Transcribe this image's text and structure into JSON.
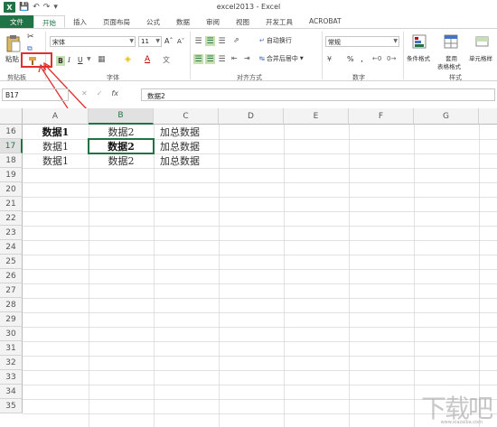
{
  "app": {
    "window_title": "excel2013 - Excel",
    "logo": "X"
  },
  "tabs": [
    "文件",
    "开始",
    "插入",
    "页面布局",
    "公式",
    "数据",
    "审阅",
    "视图",
    "开发工具",
    "ACROBAT"
  ],
  "ribbon": {
    "paste_label": "粘贴",
    "font_name": "宋体",
    "font_size": "11",
    "wrap_text": "自动换行",
    "merge_center": "合并后居中",
    "number_format": "常规",
    "percent": "%",
    "comma": ",",
    "conditional_format": "条件格式",
    "table_format_1": "套用",
    "table_format_2": "表格格式",
    "cell_style": "单元格样",
    "groups": {
      "clipboard": "剪贴板",
      "font": "字体",
      "alignment": "对齐方式",
      "number": "数字",
      "styles": "样式"
    }
  },
  "formula_bar": {
    "name_box": "B17",
    "fx": "fx",
    "content": "数据2"
  },
  "columns": [
    "A",
    "B",
    "C",
    "D",
    "E",
    "F",
    "G"
  ],
  "rows": [
    "16",
    "17",
    "18",
    "19",
    "20",
    "21",
    "22",
    "23",
    "24",
    "25",
    "26",
    "27",
    "28",
    "29",
    "30",
    "31",
    "32",
    "33",
    "34",
    "35"
  ],
  "cells": {
    "r16": {
      "a": "数据1",
      "b": "数据2",
      "c": "加总数据"
    },
    "r17": {
      "a": "数据1",
      "b": "数据2",
      "c": "加总数据"
    },
    "r18": {
      "a": "数据1",
      "b": "数据2",
      "c": "加总数据"
    }
  },
  "watermark": {
    "main": "下载吧",
    "sub": "www.xiazaiba.com"
  },
  "colors": {
    "accent": "#217346",
    "highlight": "#e03030"
  }
}
